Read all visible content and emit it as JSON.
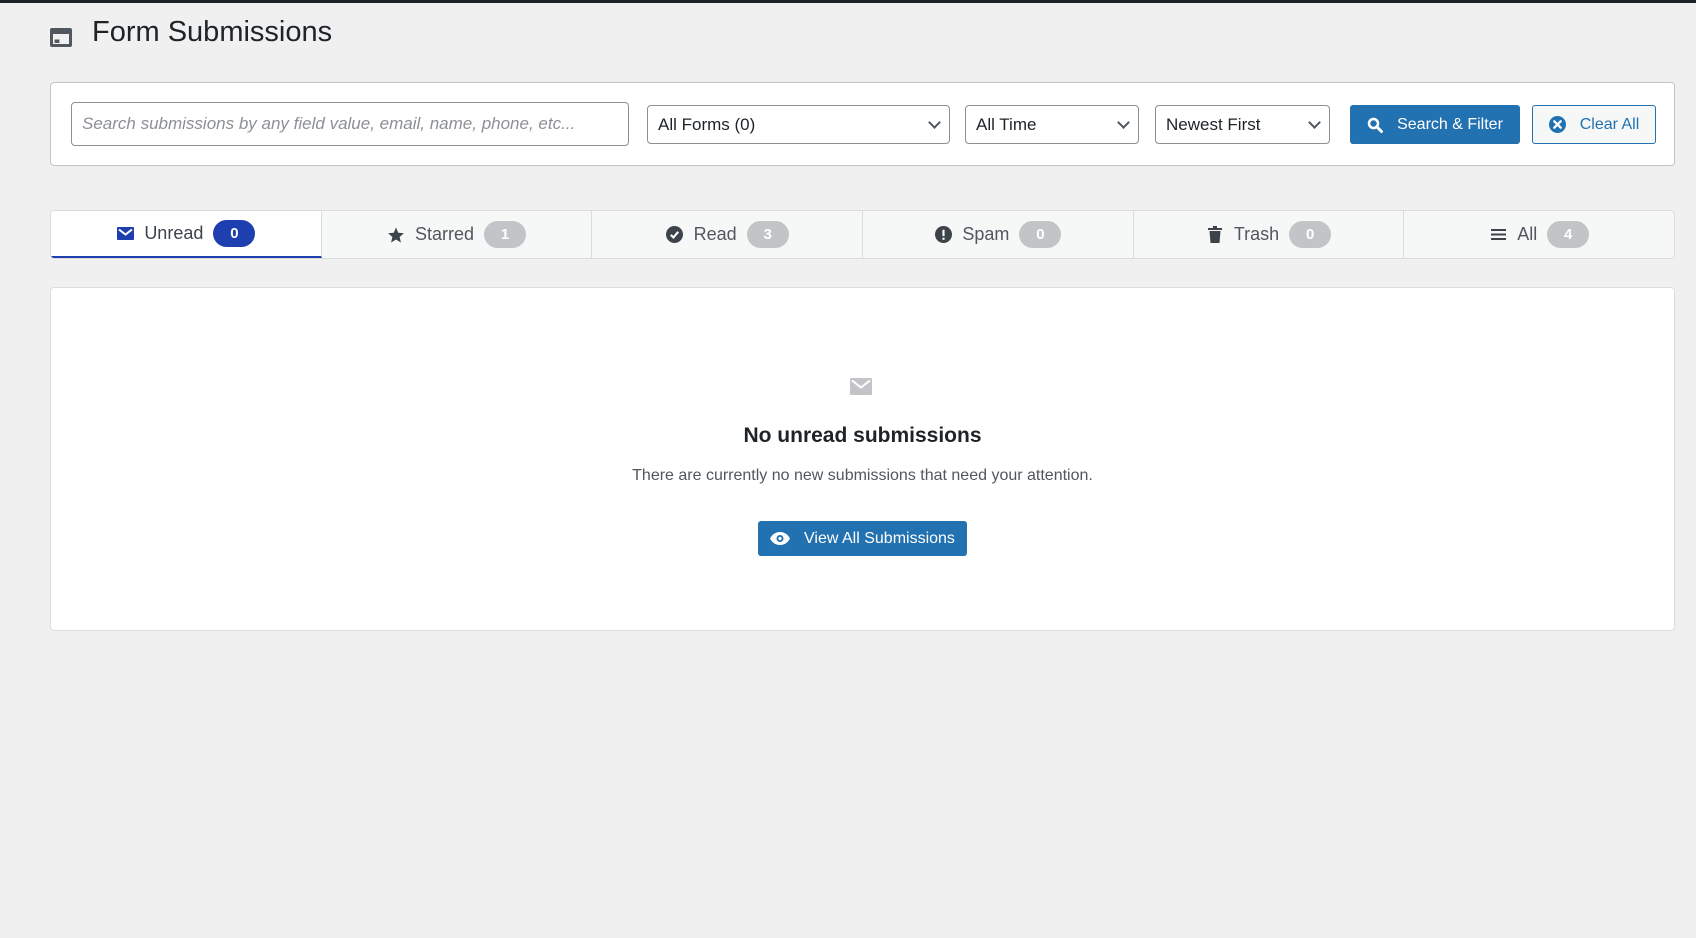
{
  "header": {
    "title": "Form Submissions",
    "icon": "table-icon"
  },
  "filters": {
    "search_placeholder": "Search submissions by any field value, email, name, phone, etc...",
    "search_value": "",
    "form_select": "All Forms (0)",
    "time_select": "All Time",
    "sort_select": "Newest First",
    "search_button": "Search & Filter",
    "clear_button": "Clear All"
  },
  "tabs": [
    {
      "label": "Unread",
      "count": "0",
      "icon": "envelope-icon",
      "active": true
    },
    {
      "label": "Starred",
      "count": "1",
      "icon": "star-icon"
    },
    {
      "label": "Read",
      "count": "3",
      "icon": "check-circle-icon"
    },
    {
      "label": "Spam",
      "count": "0",
      "icon": "exclamation-circle-icon"
    },
    {
      "label": "Trash",
      "count": "0",
      "icon": "trash-icon"
    },
    {
      "label": "All",
      "count": "4",
      "icon": "list-icon"
    }
  ],
  "empty_state": {
    "title": "No unread submissions",
    "description": "There are currently no new submissions that need your attention.",
    "button": "View All Submissions"
  },
  "colors": {
    "primary": "#2271b1",
    "active_badge": "#1d3faf",
    "badge": "#c3c4c7",
    "background": "#f0f0f1"
  }
}
